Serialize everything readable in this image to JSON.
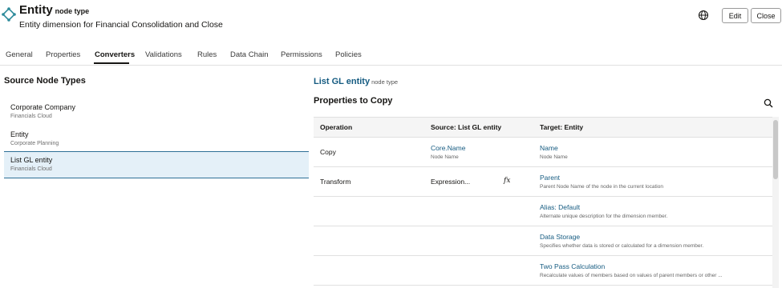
{
  "header": {
    "title": "Entity",
    "title_suffix": "node type",
    "subtitle": "Entity dimension for Financial Consolidation and Close",
    "edit_label": "Edit",
    "close_label": "Close",
    "node_icon": "node-type-icon",
    "globe_icon": "globe-icon"
  },
  "tabs": [
    {
      "label": "General"
    },
    {
      "label": "Properties"
    },
    {
      "label": "Converters",
      "active": true
    },
    {
      "label": "Validations"
    },
    {
      "label": "Rules"
    },
    {
      "label": "Data Chain"
    },
    {
      "label": "Permissions"
    },
    {
      "label": "Policies"
    }
  ],
  "source_panel": {
    "title": "Source Node Types",
    "items": [
      {
        "name": "Corporate Company",
        "app": "Financials Cloud"
      },
      {
        "name": "Entity",
        "app": "Corporate Planning"
      },
      {
        "name": "List GL entity",
        "app": "Financials Cloud",
        "selected": true
      }
    ]
  },
  "detail": {
    "title": "List GL entity",
    "title_suffix": "node type",
    "section_title": "Properties to Copy",
    "search_icon": "search-icon"
  },
  "table": {
    "columns": [
      "Operation",
      "Source: List GL entity",
      "Target: Entity"
    ],
    "rows": [
      {
        "operation": "Copy",
        "source": "Core.Name",
        "source_desc": "Node Name",
        "target": "Name",
        "target_desc": "Node Name"
      },
      {
        "operation": "Transform",
        "source": "Expression...",
        "source_desc": "",
        "fx": "fx",
        "target": "Parent",
        "target_desc": "Parent Node Name of the node in the current location"
      },
      {
        "operation": "",
        "source": "",
        "source_desc": "",
        "target": "Alias: Default",
        "target_desc": "Alternate unique description for the dimension member."
      },
      {
        "operation": "",
        "source": "",
        "source_desc": "",
        "target": "Data Storage",
        "target_desc": "Specifies whether data is stored or calculated for a dimension member."
      },
      {
        "operation": "",
        "source": "",
        "source_desc": "",
        "target": "Two Pass Calculation",
        "target_desc": "Recalculate values of members based on values of parent members or other ..."
      }
    ]
  },
  "colors": {
    "link": "#155b81",
    "selected_bg": "#e4f0f8",
    "selected_border": "#2d6f96",
    "node_icon": "#2c8a9a"
  }
}
